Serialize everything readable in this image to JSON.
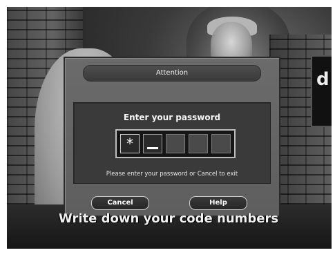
{
  "dialog": {
    "title": "Attention",
    "prompt": "Enter your password",
    "pin": {
      "slots": 5,
      "entered_char": "*",
      "entered_count": 1,
      "active_index": 1
    },
    "instruction": "Please enter your password or Cancel to exit",
    "buttons": {
      "cancel_label": "Cancel",
      "help_label": "Help"
    }
  },
  "background": {
    "subtitle": "Write down your code numbers",
    "logo_glyph": "d"
  }
}
